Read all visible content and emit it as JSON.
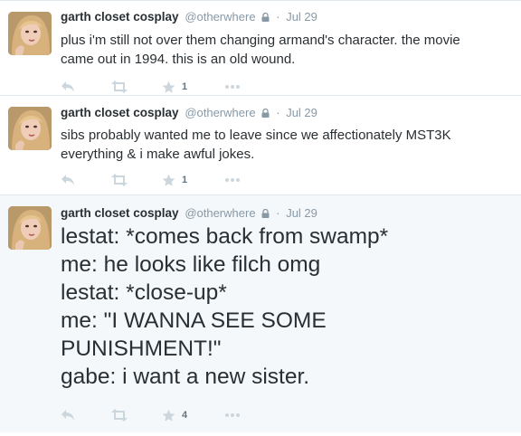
{
  "tweets": [
    {
      "name": "garth closet cosplay",
      "handle": "@otherwhere",
      "separator": "·",
      "date": "Jul 29",
      "text_lines": [
        "plus i'm still not over them changing armand's character. the movie",
        "came out in 1994. this is an old wound."
      ],
      "favorites": "1"
    },
    {
      "name": "garth closet cosplay",
      "handle": "@otherwhere",
      "separator": "·",
      "date": "Jul 29",
      "text_lines": [
        "sibs probably wanted me to leave since we affectionately MST3K",
        "everything & i make awful jokes."
      ],
      "favorites": "1"
    },
    {
      "name": "garth closet cosplay",
      "handle": "@otherwhere",
      "separator": "·",
      "date": "Jul 29",
      "text_lines": [
        "lestat: *comes back from swamp*",
        "me: he looks like filch omg",
        "lestat: *close-up*",
        "me: \"I WANNA SEE SOME",
        "PUNISHMENT!\"",
        "gabe: i want a new sister."
      ],
      "favorites": "4"
    }
  ],
  "icons": {
    "reply": "reply-icon",
    "retweet": "retweet-icon",
    "favorite": "star-icon",
    "more": "more-dots-icon",
    "lock": "lock-icon"
  },
  "colors": {
    "text": "#292f33",
    "muted": "#8899a6",
    "icon": "#ccd6dd",
    "highlight_bg": "#f5f8fa"
  }
}
